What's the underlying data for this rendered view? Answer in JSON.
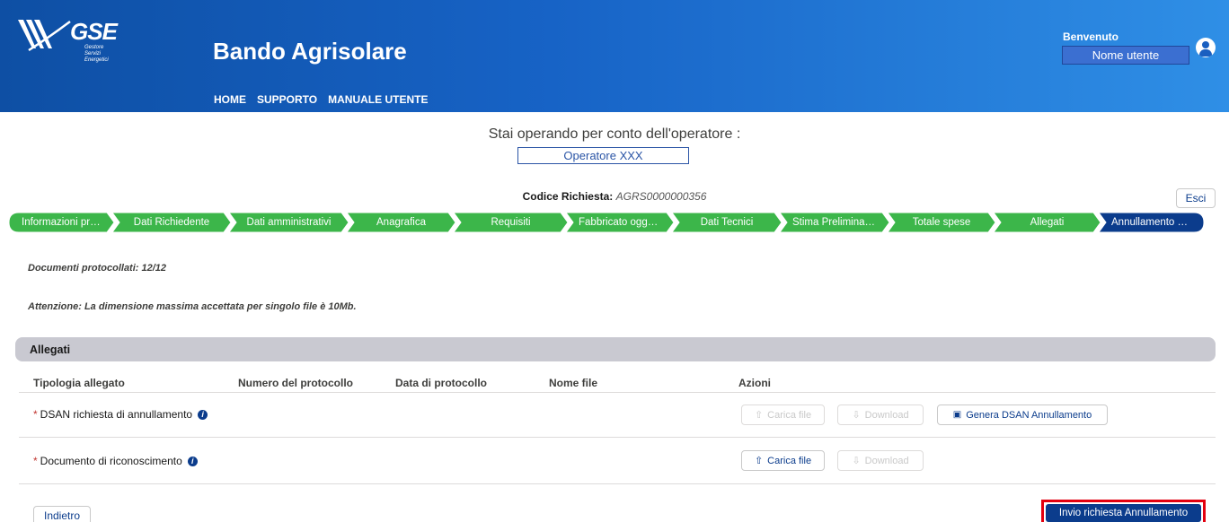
{
  "header": {
    "logo_text": "GSE",
    "logo_sub": [
      "Gestore",
      "Servizi",
      "Energetici"
    ],
    "title": "Bando Agrisolare",
    "nav": [
      "HOME",
      "SUPPORTO",
      "MANUALE UTENTE"
    ],
    "welcome": "Benvenuto",
    "user_name": "Nome utente"
  },
  "operator": {
    "label": "Stai operando per conto dell'operatore :",
    "name": "Operatore XXX"
  },
  "request": {
    "code_label": "Codice Richiesta:",
    "code_value": "AGRS0000000356",
    "exit_label": "Esci"
  },
  "steps": [
    {
      "label": "Informazioni preli...",
      "state": "done"
    },
    {
      "label": "Dati Richiedente",
      "state": "done"
    },
    {
      "label": "Dati amministrativi",
      "state": "done"
    },
    {
      "label": "Anagrafica",
      "state": "done"
    },
    {
      "label": "Requisiti",
      "state": "done"
    },
    {
      "label": "Fabbricato oggett...",
      "state": "done"
    },
    {
      "label": "Dati Tecnici",
      "state": "done"
    },
    {
      "label": "Stima Preliminare...",
      "state": "done"
    },
    {
      "label": "Totale spese",
      "state": "done"
    },
    {
      "label": "Allegati",
      "state": "done"
    },
    {
      "label": "Annullamento dell...",
      "state": "current"
    }
  ],
  "colors": {
    "done": "#3cb64a",
    "current": "#0b3c8c"
  },
  "messages": {
    "protocol_count": "Documenti protocollati: 12/12",
    "warning": "Attenzione: La dimensione massima accettata per singolo file è 10Mb."
  },
  "attachments": {
    "title": "Allegati",
    "columns": [
      "Tipologia allegato",
      "Numero del protocollo",
      "Data di protocollo",
      "Nome file",
      "Azioni"
    ],
    "rows": [
      {
        "name": "DSAN richiesta di annullamento",
        "upload": "Carica file",
        "download": "Download",
        "generate": "Genera DSAN Annullamento"
      },
      {
        "name": "Documento di riconoscimento",
        "upload": "Carica file",
        "download": "Download"
      }
    ]
  },
  "footer": {
    "back_label": "Indietro",
    "send_label": "Invio richiesta Annullamento"
  }
}
